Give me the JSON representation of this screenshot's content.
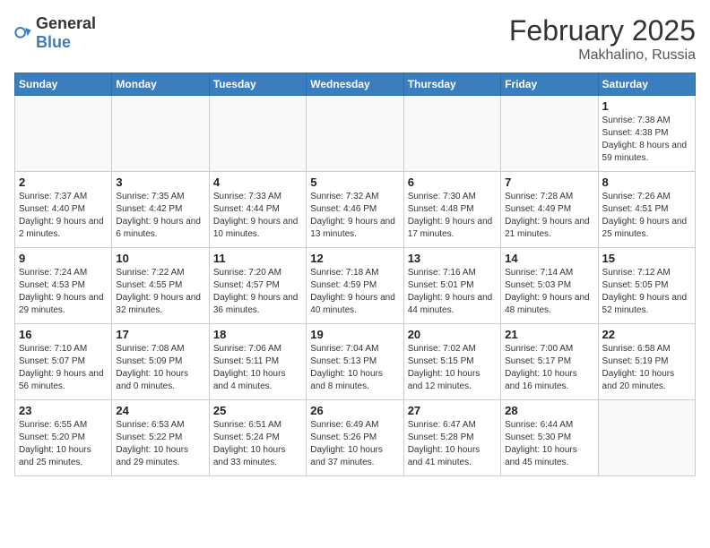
{
  "header": {
    "logo_general": "General",
    "logo_blue": "Blue",
    "month": "February 2025",
    "location": "Makhalino, Russia"
  },
  "weekdays": [
    "Sunday",
    "Monday",
    "Tuesday",
    "Wednesday",
    "Thursday",
    "Friday",
    "Saturday"
  ],
  "weeks": [
    [
      {
        "day": "",
        "info": ""
      },
      {
        "day": "",
        "info": ""
      },
      {
        "day": "",
        "info": ""
      },
      {
        "day": "",
        "info": ""
      },
      {
        "day": "",
        "info": ""
      },
      {
        "day": "",
        "info": ""
      },
      {
        "day": "1",
        "info": "Sunrise: 7:38 AM\nSunset: 4:38 PM\nDaylight: 8 hours and 59 minutes."
      }
    ],
    [
      {
        "day": "2",
        "info": "Sunrise: 7:37 AM\nSunset: 4:40 PM\nDaylight: 9 hours and 2 minutes."
      },
      {
        "day": "3",
        "info": "Sunrise: 7:35 AM\nSunset: 4:42 PM\nDaylight: 9 hours and 6 minutes."
      },
      {
        "day": "4",
        "info": "Sunrise: 7:33 AM\nSunset: 4:44 PM\nDaylight: 9 hours and 10 minutes."
      },
      {
        "day": "5",
        "info": "Sunrise: 7:32 AM\nSunset: 4:46 PM\nDaylight: 9 hours and 13 minutes."
      },
      {
        "day": "6",
        "info": "Sunrise: 7:30 AM\nSunset: 4:48 PM\nDaylight: 9 hours and 17 minutes."
      },
      {
        "day": "7",
        "info": "Sunrise: 7:28 AM\nSunset: 4:49 PM\nDaylight: 9 hours and 21 minutes."
      },
      {
        "day": "8",
        "info": "Sunrise: 7:26 AM\nSunset: 4:51 PM\nDaylight: 9 hours and 25 minutes."
      }
    ],
    [
      {
        "day": "9",
        "info": "Sunrise: 7:24 AM\nSunset: 4:53 PM\nDaylight: 9 hours and 29 minutes."
      },
      {
        "day": "10",
        "info": "Sunrise: 7:22 AM\nSunset: 4:55 PM\nDaylight: 9 hours and 32 minutes."
      },
      {
        "day": "11",
        "info": "Sunrise: 7:20 AM\nSunset: 4:57 PM\nDaylight: 9 hours and 36 minutes."
      },
      {
        "day": "12",
        "info": "Sunrise: 7:18 AM\nSunset: 4:59 PM\nDaylight: 9 hours and 40 minutes."
      },
      {
        "day": "13",
        "info": "Sunrise: 7:16 AM\nSunset: 5:01 PM\nDaylight: 9 hours and 44 minutes."
      },
      {
        "day": "14",
        "info": "Sunrise: 7:14 AM\nSunset: 5:03 PM\nDaylight: 9 hours and 48 minutes."
      },
      {
        "day": "15",
        "info": "Sunrise: 7:12 AM\nSunset: 5:05 PM\nDaylight: 9 hours and 52 minutes."
      }
    ],
    [
      {
        "day": "16",
        "info": "Sunrise: 7:10 AM\nSunset: 5:07 PM\nDaylight: 9 hours and 56 minutes."
      },
      {
        "day": "17",
        "info": "Sunrise: 7:08 AM\nSunset: 5:09 PM\nDaylight: 10 hours and 0 minutes."
      },
      {
        "day": "18",
        "info": "Sunrise: 7:06 AM\nSunset: 5:11 PM\nDaylight: 10 hours and 4 minutes."
      },
      {
        "day": "19",
        "info": "Sunrise: 7:04 AM\nSunset: 5:13 PM\nDaylight: 10 hours and 8 minutes."
      },
      {
        "day": "20",
        "info": "Sunrise: 7:02 AM\nSunset: 5:15 PM\nDaylight: 10 hours and 12 minutes."
      },
      {
        "day": "21",
        "info": "Sunrise: 7:00 AM\nSunset: 5:17 PM\nDaylight: 10 hours and 16 minutes."
      },
      {
        "day": "22",
        "info": "Sunrise: 6:58 AM\nSunset: 5:19 PM\nDaylight: 10 hours and 20 minutes."
      }
    ],
    [
      {
        "day": "23",
        "info": "Sunrise: 6:55 AM\nSunset: 5:20 PM\nDaylight: 10 hours and 25 minutes."
      },
      {
        "day": "24",
        "info": "Sunrise: 6:53 AM\nSunset: 5:22 PM\nDaylight: 10 hours and 29 minutes."
      },
      {
        "day": "25",
        "info": "Sunrise: 6:51 AM\nSunset: 5:24 PM\nDaylight: 10 hours and 33 minutes."
      },
      {
        "day": "26",
        "info": "Sunrise: 6:49 AM\nSunset: 5:26 PM\nDaylight: 10 hours and 37 minutes."
      },
      {
        "day": "27",
        "info": "Sunrise: 6:47 AM\nSunset: 5:28 PM\nDaylight: 10 hours and 41 minutes."
      },
      {
        "day": "28",
        "info": "Sunrise: 6:44 AM\nSunset: 5:30 PM\nDaylight: 10 hours and 45 minutes."
      },
      {
        "day": "",
        "info": ""
      }
    ]
  ]
}
